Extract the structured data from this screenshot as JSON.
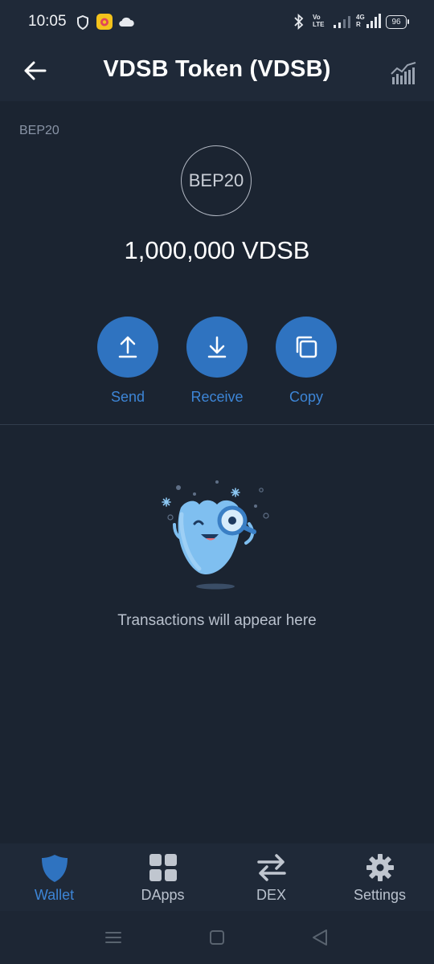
{
  "status_bar": {
    "time": "10:05",
    "battery": "96",
    "network_top": "Vo",
    "network_bottom": "LTE",
    "signal_top": "4G",
    "signal_bottom": "R",
    "icons": [
      "shield-icon",
      "camera-app-icon",
      "cloud-icon",
      "bluetooth-icon",
      "signal-icon",
      "battery-icon"
    ]
  },
  "header": {
    "title": "VDSB Token (VDSB)",
    "back_icon": "arrow-left-icon",
    "chart_icon": "price-chart-icon"
  },
  "token": {
    "network": "BEP20",
    "logo_text": "BEP20",
    "balance": "1,000,000 VDSB"
  },
  "actions": [
    {
      "label": "Send",
      "icon": "arrow-up-icon"
    },
    {
      "label": "Receive",
      "icon": "arrow-down-icon"
    },
    {
      "label": "Copy",
      "icon": "copy-icon"
    }
  ],
  "empty_state": {
    "text": "Transactions will appear here",
    "icon": "magnifier-mascot-icon"
  },
  "bottom_nav": [
    {
      "label": "Wallet",
      "icon": "shield-icon",
      "active": true
    },
    {
      "label": "DApps",
      "icon": "grid-icon",
      "active": false
    },
    {
      "label": "DEX",
      "icon": "swap-icon",
      "active": false
    },
    {
      "label": "Settings",
      "icon": "gear-icon",
      "active": false
    }
  ],
  "colors": {
    "background": "#1b2431",
    "header": "#1f2938",
    "accent": "#2f73c0",
    "accent_text": "#3d85d6"
  }
}
